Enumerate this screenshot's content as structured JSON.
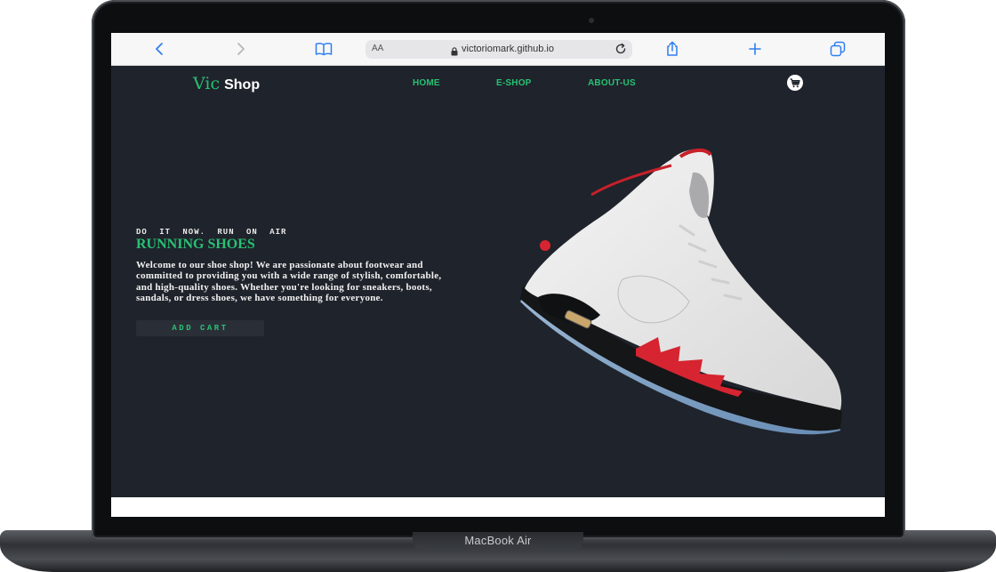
{
  "device": {
    "model_label": "MacBook Air"
  },
  "browser": {
    "text_size_label": "AA",
    "url": "victoriomark.github.io",
    "icons": [
      "back-icon",
      "forward-icon",
      "bookmarks-icon",
      "lock-icon",
      "reload-icon",
      "share-icon",
      "new-tab-icon",
      "tabs-icon"
    ]
  },
  "site": {
    "logo": {
      "part1": "Vic",
      "part2": "Shop"
    },
    "nav": [
      {
        "label": "HOME"
      },
      {
        "label": "E-SHOP"
      },
      {
        "label": "ABOUT-US"
      }
    ],
    "cart_icon": "cart-icon"
  },
  "hero": {
    "kicker": "DO IT NOW. RUN ON AIR",
    "title": "RUNNING SHOES",
    "description": "Welcome to our shoe shop! We are passionate about footwear and committed to providing you with a wide range of stylish, comfortable, and high-quality shoes. Whether you're looking for sneakers, boots, sandals, or dress shoes, we have something for everyone.",
    "button_label": "ADD CART",
    "image": "sneaker-image"
  },
  "colors": {
    "accent": "#27c174",
    "page_bg": "#1f232b",
    "button_bg": "#2a2f37",
    "toolbar_bg": "#f7f7f8",
    "browser_blue": "#2f7ff0"
  }
}
